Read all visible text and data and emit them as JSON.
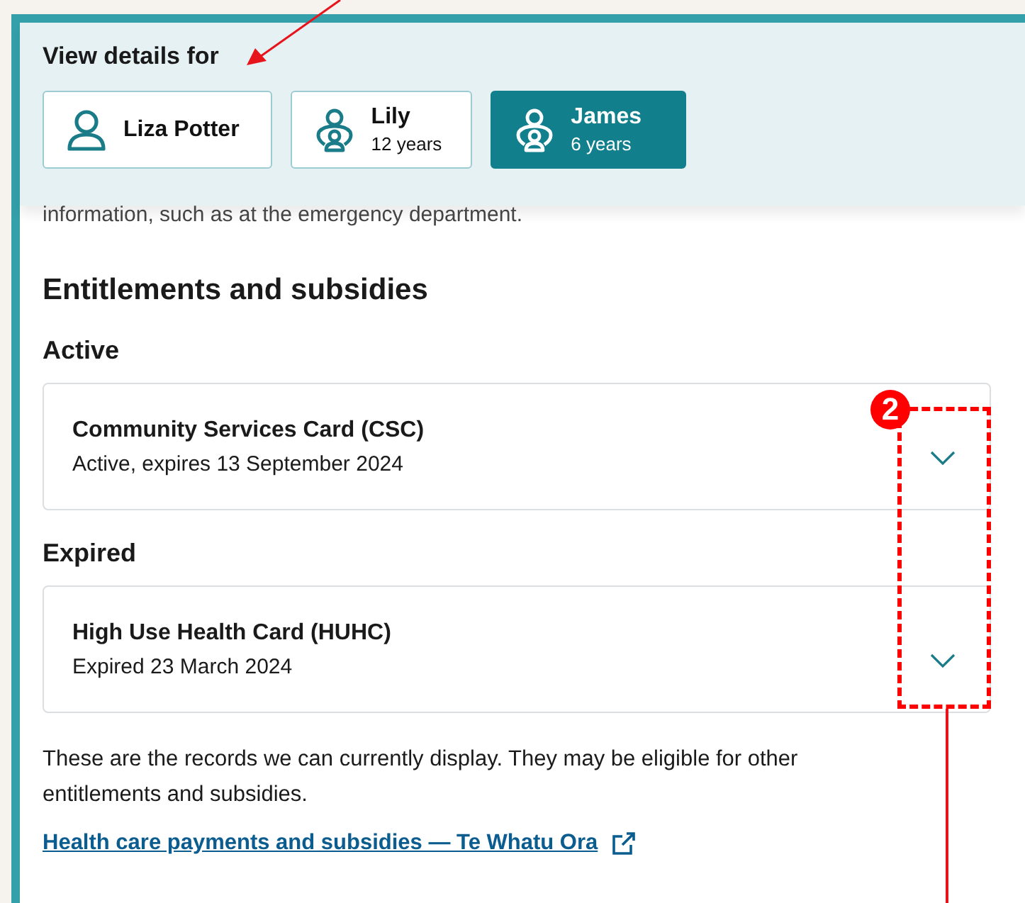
{
  "header": {
    "title": "View details for",
    "people": [
      {
        "kind": "adult",
        "name": "Liza Potter",
        "selected": false
      },
      {
        "kind": "child",
        "name": "Lily",
        "age": "12 years",
        "selected": false
      },
      {
        "kind": "child",
        "name": "James",
        "age": "6 years",
        "selected": true
      }
    ]
  },
  "intro_fragment": "information, such as at the emergency department.",
  "section": {
    "title": "Entitlements and subsidies",
    "groups": [
      {
        "title": "Active",
        "cards": [
          {
            "title": "Community Services Card (CSC)",
            "status": "Active, expires 13 September 2024",
            "expanded": false
          }
        ]
      },
      {
        "title": "Expired",
        "cards": [
          {
            "title": "High Use Health Card (HUHC)",
            "status": "Expired 23 March 2024",
            "expanded": false
          }
        ]
      }
    ]
  },
  "note": "These are the records we can currently display. They may be eligible for other entitlements and subsidies.",
  "link": "Health care payments and subsidies — Te Whatu Ora",
  "annotation": {
    "badge": "2"
  }
}
